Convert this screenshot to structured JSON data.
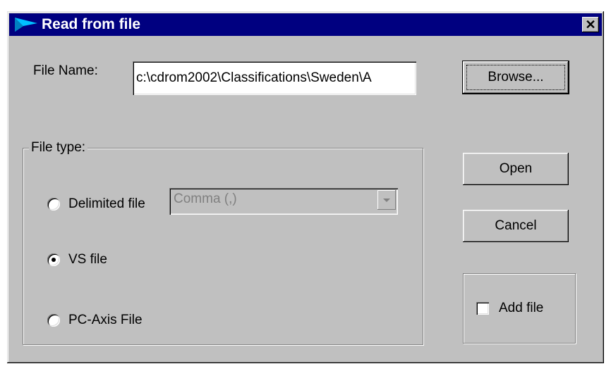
{
  "window": {
    "title": "Read from file",
    "icon": "app-icon",
    "close_label": "✕"
  },
  "file_name": {
    "label": "File Name:",
    "value": "c:\\cdrom2002\\Classifications\\Sweden\\A"
  },
  "buttons": {
    "browse": "Browse...",
    "open": "Open",
    "cancel": "Cancel"
  },
  "file_type": {
    "legend": "File type:",
    "options": [
      {
        "label": "Delimited file",
        "selected": false
      },
      {
        "label": "VS file",
        "selected": true
      },
      {
        "label": "PC-Axis File",
        "selected": false
      }
    ],
    "delimiter": {
      "selected": "Comma (,)",
      "enabled": false
    }
  },
  "add_file": {
    "label": "Add file",
    "checked": false
  },
  "colors": {
    "titlebar": "#000080",
    "face": "#c0c0c0"
  }
}
